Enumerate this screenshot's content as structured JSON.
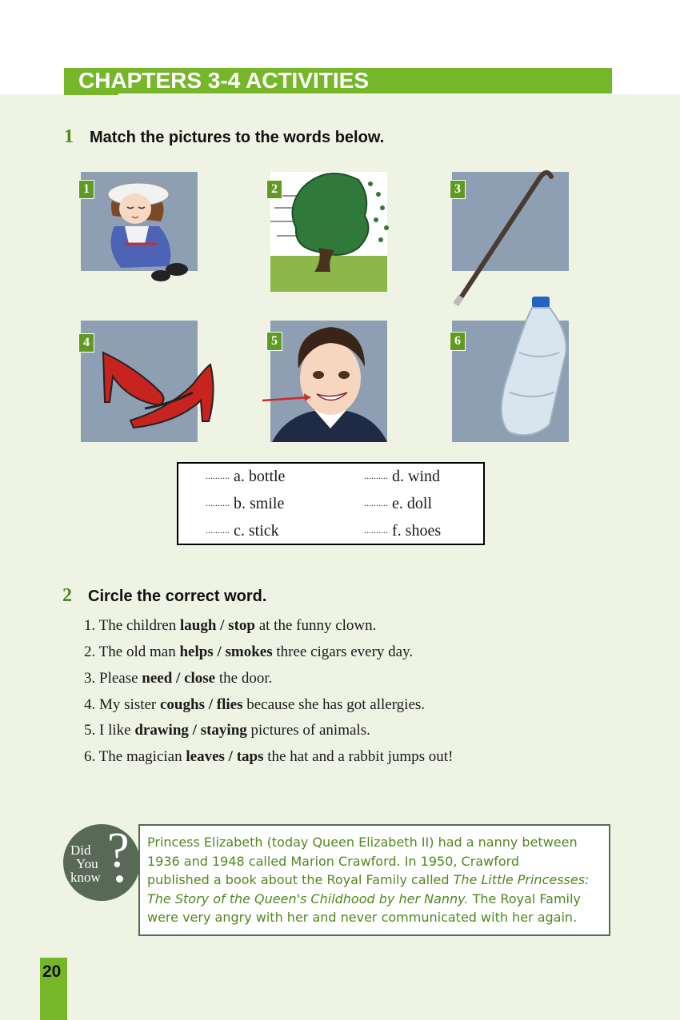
{
  "header": {
    "title": "CHAPTERS 3-4 ACTIVITIES"
  },
  "activity1": {
    "number": "1",
    "instruction": "Match the pictures to the words below.",
    "pictures": [
      {
        "label": "1",
        "icon": "doll-icon"
      },
      {
        "label": "2",
        "icon": "windy-tree-icon"
      },
      {
        "label": "3",
        "icon": "walking-stick-icon"
      },
      {
        "label": "4",
        "icon": "red-shoes-icon"
      },
      {
        "label": "5",
        "icon": "smiling-boy-icon"
      },
      {
        "label": "6",
        "icon": "plastic-bottle-icon"
      }
    ],
    "words": [
      {
        "blank": "..........",
        "letter": "a.",
        "word": "bottle"
      },
      {
        "blank": "..........",
        "letter": "b.",
        "word": "smile"
      },
      {
        "blank": "..........",
        "letter": "c.",
        "word": "stick"
      },
      {
        "blank": "..........",
        "letter": "d.",
        "word": "wind"
      },
      {
        "blank": "..........",
        "letter": "e.",
        "word": "doll"
      },
      {
        "blank": "..........",
        "letter": "f.",
        "word": "shoes"
      }
    ]
  },
  "activity2": {
    "number": "2",
    "instruction": "Circle the correct word.",
    "sentences": [
      {
        "num": "1.",
        "pre": "The children ",
        "opt1": "laugh",
        "sep": " / ",
        "opt2": "stop",
        "post": " at the funny clown."
      },
      {
        "num": "2.",
        "pre": "The old man ",
        "opt1": "helps",
        "sep": " / ",
        "opt2": "smokes",
        "post": " three cigars every day."
      },
      {
        "num": "3.",
        "pre": "Please ",
        "opt1": "need",
        "sep": " / ",
        "opt2": "close",
        "post": " the door."
      },
      {
        "num": "4.",
        "pre": "My sister ",
        "opt1": "coughs",
        "sep": " / ",
        "opt2": "flies",
        "post": " because she has got allergies."
      },
      {
        "num": "5.",
        "pre": "I like ",
        "opt1": "drawing",
        "sep": " / ",
        "opt2": "staying",
        "post": " pictures of animals."
      },
      {
        "num": "6.",
        "pre": "The magician ",
        "opt1": "leaves",
        "sep": " / ",
        "opt2": "taps",
        "post": " the hat and a rabbit jumps out!"
      }
    ]
  },
  "did_you_know": {
    "badge": [
      "Did",
      "You",
      "know"
    ],
    "lines": [
      "Princess Elizabeth (today Queen Elizabeth II) had a nanny between",
      "1936 and 1948 called Marion Crawford. In 1950, Crawford",
      "published a book about the Royal Family called ",
      "The Little Princesses:",
      "The Story of the Queen's Childhood by her Nanny.",
      " The Royal Family",
      "were very angry with her and never communicated with her again."
    ]
  },
  "page_number": "20",
  "colors": {
    "accent_green": "#76b72a",
    "dark_green": "#4f8a1e",
    "badge_gray": "#586a55",
    "page_bg": "#eef3e4"
  }
}
